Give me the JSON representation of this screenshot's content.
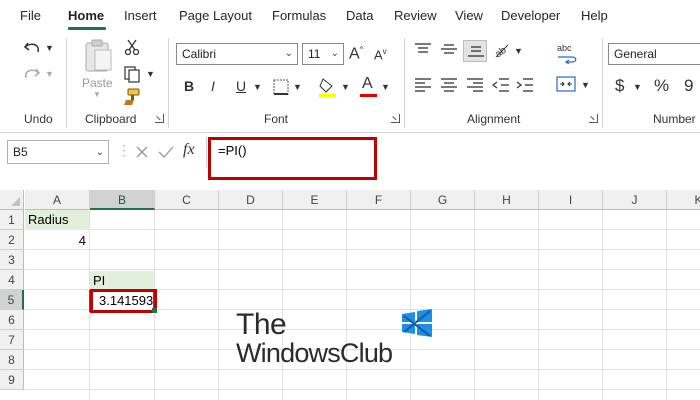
{
  "menu": {
    "tabs": [
      "File",
      "Home",
      "Insert",
      "Page Layout",
      "Formulas",
      "Data",
      "Review",
      "View",
      "Developer",
      "Help"
    ],
    "active": "Home"
  },
  "ribbon": {
    "groups": {
      "undo": "Undo",
      "clipboard": "Clipboard",
      "font": "Font",
      "alignment": "Alignment",
      "number": "Number"
    },
    "paste_label": "Paste",
    "font_name": "Calibri",
    "font_size": "11",
    "font_buttons": {
      "bold": "B",
      "italic": "I",
      "underline": "U",
      "grow": "A",
      "shrink": "A",
      "color": "A"
    },
    "number_format": "General",
    "number_buttons": {
      "currency": "$",
      "percent": "%",
      "comma": "9"
    },
    "fx_label": "fx",
    "wrap_label": "ab c"
  },
  "formula_bar": {
    "name_box": "B5",
    "formula": "=PI()"
  },
  "sheet": {
    "columns": [
      "A",
      "B",
      "C",
      "D",
      "E",
      "F",
      "G",
      "H",
      "I",
      "J",
      "K"
    ],
    "rows": [
      "1",
      "2",
      "3",
      "4",
      "5",
      "6",
      "7",
      "8",
      "9"
    ],
    "cells": {
      "A1": "Radius",
      "A2": "4",
      "B4": "PI",
      "B5": "3.141593"
    },
    "selected_cell": "B5",
    "highlight_color": "#c00000",
    "input_fill": "#e2efda"
  },
  "watermark": {
    "line1": "The",
    "line2": "WindowsClub"
  },
  "colors": {
    "excel_green": "#217346",
    "logo_blue": "#1e8ee6"
  }
}
